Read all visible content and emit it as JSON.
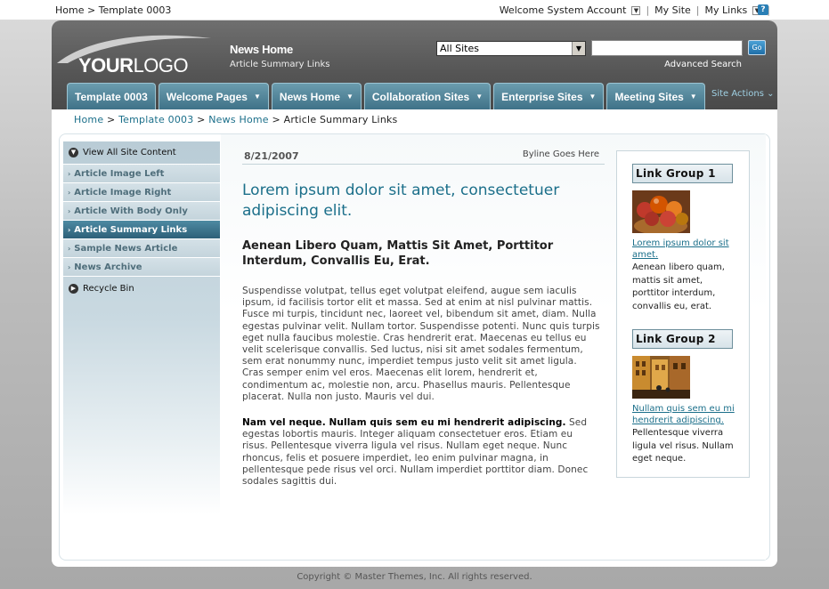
{
  "top": {
    "breadcrumb": "Home > Template 0003",
    "welcome": "Welcome System Account",
    "my_site": "My Site",
    "my_links": "My Links"
  },
  "header": {
    "logo_bold": "YOUR",
    "logo_rest": "LOGO",
    "site_title": "News Home",
    "site_subtitle": "Article Summary Links",
    "scope_value": "All Sites",
    "search_placeholder": "",
    "go_label": "Go",
    "advanced_search": "Advanced Search",
    "site_actions": "Site Actions"
  },
  "tabs": [
    {
      "label": "Template 0003",
      "dropdown": false
    },
    {
      "label": "Welcome Pages",
      "dropdown": true
    },
    {
      "label": "News Home",
      "dropdown": true
    },
    {
      "label": "Collaboration Sites",
      "dropdown": true
    },
    {
      "label": "Enterprise Sites",
      "dropdown": true
    },
    {
      "label": "Meeting Sites",
      "dropdown": true
    }
  ],
  "breadcrumb": {
    "items": [
      "Home",
      "Template 0003",
      "News Home"
    ],
    "current": "Article Summary Links"
  },
  "leftnav": {
    "view_all": "View All Site Content",
    "items": [
      {
        "label": "Article Image Left",
        "active": false
      },
      {
        "label": "Article Image Right",
        "active": false
      },
      {
        "label": "Article With Body Only",
        "active": false
      },
      {
        "label": "Article Summary Links",
        "active": true
      },
      {
        "label": "Sample News Article",
        "active": false
      },
      {
        "label": "News Archive",
        "active": false
      }
    ],
    "recycle_bin": "Recycle Bin"
  },
  "article": {
    "date": "8/21/2007",
    "byline": "Byline Goes Here",
    "title": "Lorem ipsum dolor sit amet, consectetuer adipiscing elit.",
    "subtitle": "Aenean Libero Quam, Mattis Sit Amet, Porttitor Interdum, Convallis Eu, Erat.",
    "body1": "Suspendisse volutpat, tellus eget volutpat eleifend, augue sem iaculis ipsum, id facilisis tortor elit et massa. Sed at enim at nisl pulvinar mattis. Fusce mi turpis, tincidunt nec, laoreet vel, bibendum sit amet, diam. Nulla egestas pulvinar velit. Nullam tortor. Suspendisse potenti. Nunc quis turpis eget nulla faucibus molestie. Cras hendrerit erat. Maecenas eu tellus eu velit scelerisque convallis. Sed luctus, nisi sit amet sodales fermentum, sem erat nonummy nunc, imperdiet tempus justo velit sit amet ligula. Cras semper enim vel eros. Maecenas elit lorem, hendrerit et, condimentum ac, molestie non, arcu. Phasellus mauris. Pellentesque placerat. Nulla non justo. Mauris vel dui.",
    "body2_lead": "Nam vel neque. Nullam quis sem eu mi hendrerit adipiscing.",
    "body2": " Sed egestas lobortis mauris. Integer aliquam consectetuer eros. Etiam eu risus. Pellentesque viverra ligula vel risus. Nullam eget neque. Nunc rhoncus, felis et posuere imperdiet, leo enim pulvinar magna, in pellentesque pede risus vel orci. Nullam imperdiet porttitor diam. Donec sodales sagittis dui."
  },
  "link_groups": [
    {
      "title": "Link Group 1",
      "link": "Lorem ipsum dolor sit amet.",
      "text": "Aenean libero quam, mattis sit amet, porttitor interdum, convallis eu, erat."
    },
    {
      "title": "Link Group 2",
      "link": "Nullam quis sem eu mi hendrerit adipiscing.",
      "text": "Pellentesque viverra ligula vel risus. Nullam eget neque."
    }
  ],
  "footer": "Copyright © Master Themes, Inc. All rights reserved."
}
